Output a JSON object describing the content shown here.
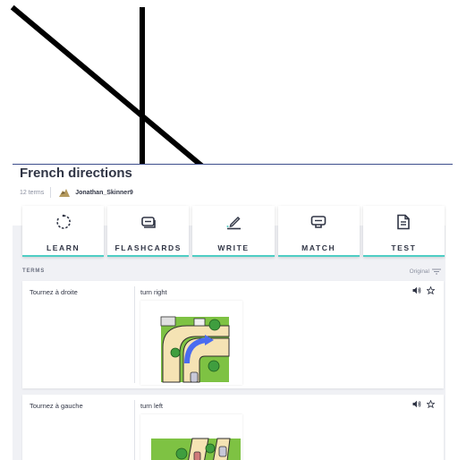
{
  "set": {
    "title": "French directions",
    "term_count": "12 terms",
    "username": "Jonathan_Skinner9"
  },
  "modes": [
    {
      "label": "LEARN",
      "icon": "learn-icon"
    },
    {
      "label": "FLASHCARDS",
      "icon": "flashcards-icon"
    },
    {
      "label": "WRITE",
      "icon": "write-icon"
    },
    {
      "label": "MATCH",
      "icon": "match-icon"
    },
    {
      "label": "TEST",
      "icon": "test-icon"
    }
  ],
  "terms_section": {
    "label": "TERMS",
    "sort_label": "Original"
  },
  "cards": [
    {
      "term": "Tournez à droite",
      "definition": "turn right",
      "image": "turn-right-map-image"
    },
    {
      "term": "Tournez à gauche",
      "definition": "turn left",
      "image": "turn-left-map-image"
    }
  ],
  "colors": {
    "accent": "#4fcdc4",
    "divider": "#3d4f8c",
    "text": "#303545",
    "background": "#f0f1f5"
  }
}
